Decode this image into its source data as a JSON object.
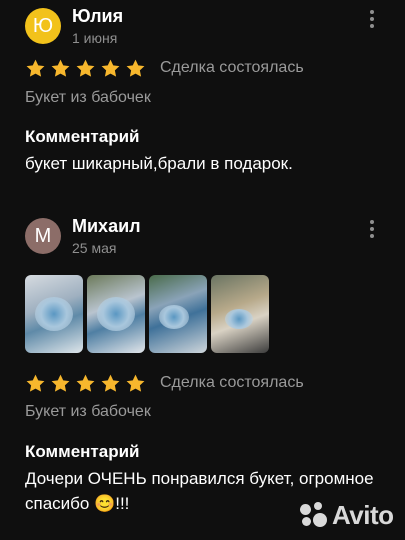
{
  "reviews": [
    {
      "avatar_letter": "Ю",
      "author": "Юлия",
      "date": "1 июня",
      "rating": 5,
      "deal_status": "Сделка состоялась",
      "product": "Букет из бабочек",
      "comment_title": "Комментарий",
      "comment_text": "букет шикарный,брали в подарок."
    },
    {
      "avatar_letter": "М",
      "author": "Михаил",
      "date": "25 мая",
      "rating": 5,
      "deal_status": "Сделка состоялась",
      "product": "Букет из бабочек",
      "comment_title": "Комментарий",
      "comment_text": "Дочери ОЧЕНЬ понравился букет, огромное спасибо 😊!!!",
      "photos_count": 4
    }
  ],
  "watermark": {
    "brand": "Avito"
  },
  "colors": {
    "star": "#f7b72d",
    "avatar_1": "#f2c21b",
    "avatar_2": "#8c6d68",
    "background": "#0f0f0f"
  },
  "icons": {
    "menu": "more-vertical-icon",
    "star": "star-icon"
  }
}
